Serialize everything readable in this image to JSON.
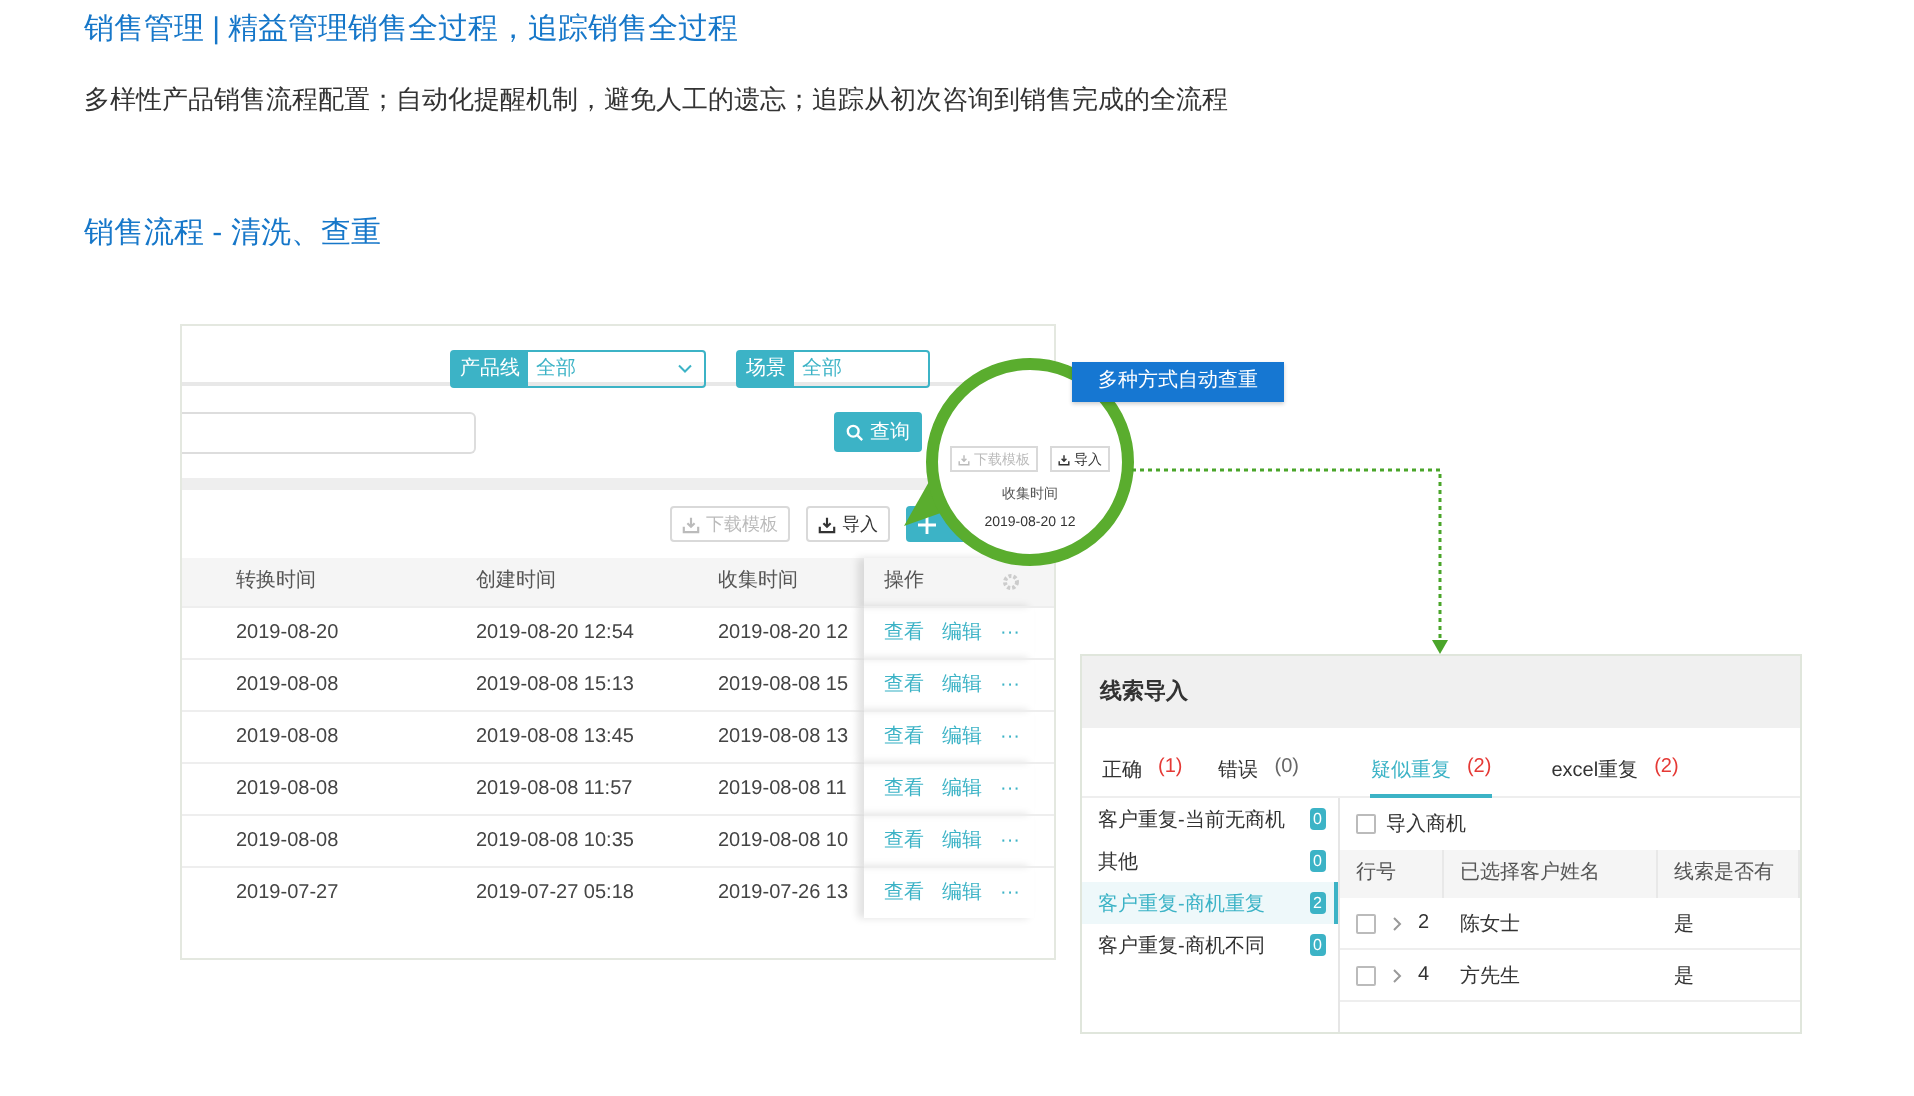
{
  "header": {
    "title": "销售管理 | 精益管理销售全过程，追踪销售全过程",
    "description": "多样性产品销售流程配置；自动化提醒机制，避免人工的遗忘；追踪从初次咨询到销售完成的全流程",
    "subtitle": "销售流程 - 清洗、查重"
  },
  "figure": {
    "filters": [
      {
        "label": "产品线",
        "value": "全部"
      },
      {
        "label": "场景",
        "value": "全部"
      }
    ],
    "search_button": "查询",
    "toolbar": {
      "download": "下载模板",
      "import": "导入"
    },
    "table": {
      "columns": [
        "转换时间",
        "创建时间",
        "收集时间",
        "操作"
      ],
      "rows": [
        {
          "cells": [
            "2019-08-20",
            "2019-08-20 12:54",
            "2019-08-20 12"
          ],
          "actions": [
            "查看",
            "编辑",
            "···"
          ]
        },
        {
          "cells": [
            "2019-08-08",
            "2019-08-08 15:13",
            "2019-08-08 15"
          ],
          "actions": [
            "查看",
            "编辑",
            "···"
          ]
        },
        {
          "cells": [
            "2019-08-08",
            "2019-08-08 13:45",
            "2019-08-08 13"
          ],
          "actions": [
            "查看",
            "编辑",
            "···"
          ]
        },
        {
          "cells": [
            "2019-08-08",
            "2019-08-08 11:57",
            "2019-08-08 11"
          ],
          "actions": [
            "查看",
            "编辑",
            "···"
          ]
        },
        {
          "cells": [
            "2019-08-08",
            "2019-08-08 10:35",
            "2019-08-08 10"
          ],
          "actions": [
            "查看",
            "编辑",
            "···"
          ]
        },
        {
          "cells": [
            "2019-07-27",
            "2019-07-27 05:18",
            "2019-07-26 13"
          ],
          "actions": [
            "查看",
            "编辑",
            "···"
          ]
        }
      ]
    },
    "magnifier": {
      "download": "下载模板",
      "import": "导入",
      "column": "收集时间",
      "cell": "2019-08-20 12"
    },
    "callout": "多种方式自动查重",
    "dialog": {
      "title": "线索导入",
      "tabs": [
        {
          "label": "正确",
          "count": "(1)",
          "color": "#e53935",
          "selected": false
        },
        {
          "label": "错误",
          "count": "(0)",
          "color": "#666666",
          "selected": false
        },
        {
          "label": "疑似重复",
          "count": "(2)",
          "color": "#e53935",
          "selected": true
        },
        {
          "label": "excel重复",
          "count": "(2)",
          "color": "#e53935",
          "selected": false
        }
      ],
      "categories": [
        {
          "label": "客户重复-当前无商机",
          "count": "0",
          "selected": false
        },
        {
          "label": "其他",
          "count": "0",
          "selected": false
        },
        {
          "label": "客户重复-商机重复",
          "count": "2",
          "selected": true
        },
        {
          "label": "客户重复-商机不同",
          "count": "0",
          "selected": false
        }
      ],
      "checkbox": {
        "label": "导入商机",
        "checked": false
      },
      "columns": [
        "行号",
        "已选择客户姓名",
        "线索是否有"
      ],
      "rows": [
        {
          "checked": false,
          "number": "2",
          "name": "陈女士",
          "value": "是"
        },
        {
          "checked": false,
          "number": "4",
          "name": "方先生",
          "value": "是"
        }
      ]
    }
  }
}
